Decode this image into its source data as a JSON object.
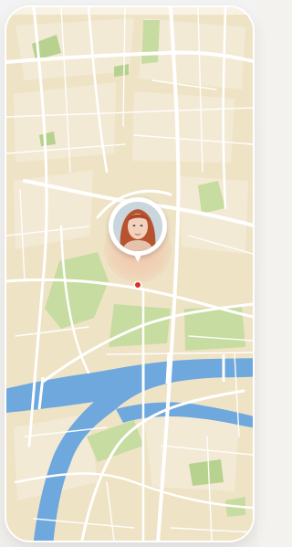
{
  "app": {
    "screen": "map-location-view"
  },
  "colors": {
    "land": "#efe3c6",
    "block": "#f1e8d2",
    "park": "#c7dca0",
    "park_dark": "#b7d18e",
    "water": "#6fa8dd",
    "road": "#ffffff",
    "accent_dot": "#d9322a",
    "pulse": "#f18c78"
  },
  "map": {
    "icon": "map-icon",
    "has_river": true,
    "has_parks": true
  },
  "user_marker": {
    "icon": "user-avatar-icon",
    "location_icon": "location-dot-icon"
  }
}
